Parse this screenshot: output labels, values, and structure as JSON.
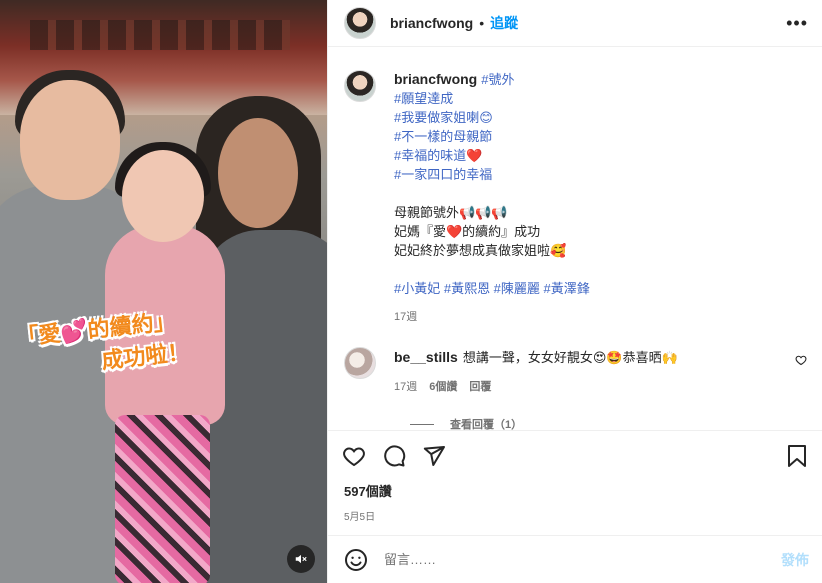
{
  "post": {
    "username": "briancfwong",
    "follow_label": "追蹤",
    "more_label": "•••"
  },
  "photo": {
    "sticker_line1_a": "「愛",
    "sticker_heart": "💕",
    "sticker_line1_b": "的續約」",
    "sticker_line2": "成功啦！"
  },
  "caption": {
    "username": "briancfwong",
    "lines": [
      "#號外",
      "#願望達成",
      "#我要做家姐喇😊",
      "#不一樣的母親節",
      "#幸福的味道❤️",
      "#一家四口的幸福"
    ],
    "body": [
      "母親節號外📢📢📢",
      "妃媽『愛❤️的續約』成功",
      "妃妃終於夢想成真做家姐啦🥰"
    ],
    "tags": "#小黃妃 #黃熙恩 #陳麗麗 #黃澤鋒",
    "time": "17週"
  },
  "comment": {
    "username": "be__stills",
    "text": "想講一聲，女女好靚女😍🤩恭喜晒🙌",
    "time": "17週",
    "likes": "6個讚",
    "reply": "回覆",
    "view_replies": "查看回覆（1）"
  },
  "actions": {
    "likes": "597個讚",
    "date": "5月5日"
  },
  "add_comment": {
    "placeholder": "留言……",
    "post_label": "發佈"
  }
}
